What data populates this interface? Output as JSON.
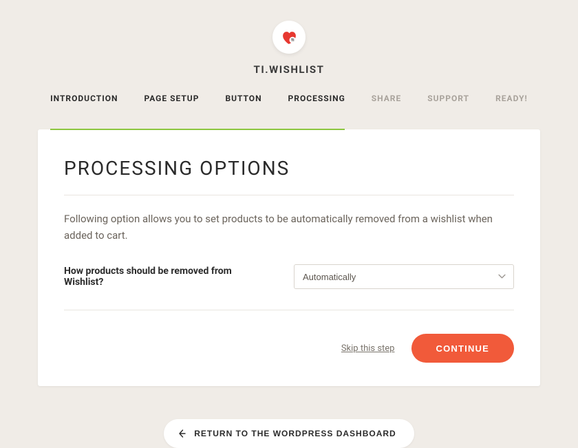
{
  "brand": "TI.WISHLIST",
  "tabs": {
    "items": [
      {
        "label": "INTRODUCTION",
        "state": "completed"
      },
      {
        "label": "PAGE SETUP",
        "state": "completed"
      },
      {
        "label": "BUTTON",
        "state": "completed"
      },
      {
        "label": "PROCESSING",
        "state": "active"
      },
      {
        "label": "SHARE",
        "state": "upcoming"
      },
      {
        "label": "SUPPORT",
        "state": "upcoming"
      },
      {
        "label": "READY!",
        "state": "upcoming"
      }
    ]
  },
  "card": {
    "title": "PROCESSING OPTIONS",
    "description": "Following option allows you to set products to be automatically removed from a wishlist when added to cart.",
    "field_label": "How products should be removed from Wishlist?",
    "select_value": "Automatically"
  },
  "actions": {
    "skip": "Skip this step",
    "continue": "CONTINUE"
  },
  "footer": {
    "return": "RETURN TO THE WORDPRESS DASHBOARD"
  },
  "colors": {
    "accent_green": "#8cc63f",
    "accent_orange": "#f15a3a",
    "heart_red": "#e73830"
  }
}
